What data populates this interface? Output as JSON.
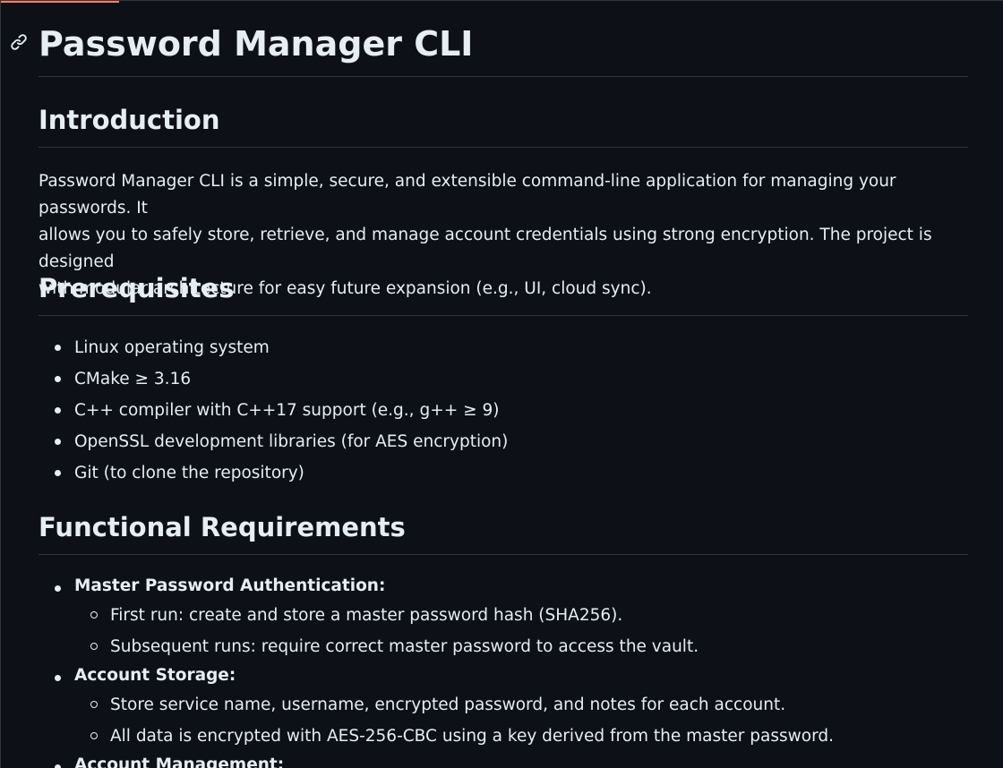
{
  "title": "Password Manager CLI",
  "sections": {
    "introduction": {
      "heading": "Introduction",
      "paragraph_lines": [
        "Password Manager CLI is a simple, secure, and extensible command-line application for managing your passwords. It",
        "allows you to safely store, retrieve, and manage account credentials using strong encryption. The project is designed",
        "with modular architecture for easy future expansion (e.g., UI, cloud sync)."
      ]
    },
    "prerequisites": {
      "heading": "Prerequisites",
      "items": [
        "Linux operating system",
        "CMake ≥ 3.16",
        "C++ compiler with C++17 support (e.g., g++ ≥ 9)",
        "OpenSSL development libraries (for AES encryption)",
        "Git (to clone the repository)"
      ]
    },
    "functional_requirements": {
      "heading": "Functional Requirements",
      "items": [
        {
          "label": "Master Password Authentication:",
          "subitems": [
            "First run: create and store a master password hash (SHA256).",
            "Subsequent runs: require correct master password to access the vault."
          ]
        },
        {
          "label": "Account Storage:",
          "subitems": [
            "Store service name, username, encrypted password, and notes for each account.",
            "All data is encrypted with AES-256-CBC using a key derived from the master password."
          ]
        },
        {
          "label": "Account Management:",
          "subitems": []
        }
      ]
    }
  },
  "icons": {
    "heading_anchor": "link-icon"
  },
  "colors": {
    "background": "#0d1117",
    "text": "#e6edf3",
    "divider": "#30363d",
    "accent": "#f78166"
  }
}
